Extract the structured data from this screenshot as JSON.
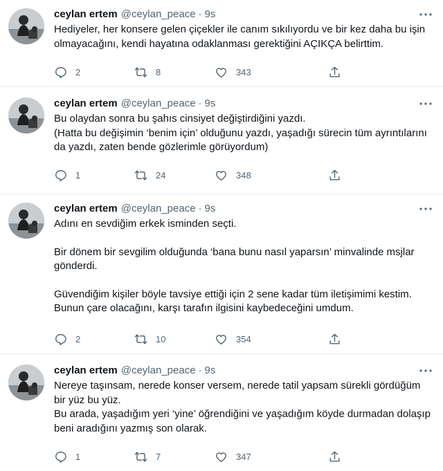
{
  "tweets": [
    {
      "name": "ceylan ertem",
      "handle": "@ceylan_peace",
      "separator": "·",
      "time": "9s",
      "paragraphs": [
        "Hediyeler, her konsere gelen çiçekler ile canım sıkılıyordu ve bir kez daha bu işin olmayacağını, kendi hayatına odaklanması gerektiğini AÇIKÇA belirttim."
      ],
      "replies": "2",
      "retweets": "8",
      "likes": "343"
    },
    {
      "name": "ceylan ertem",
      "handle": "@ceylan_peace",
      "separator": "·",
      "time": "9s",
      "paragraphs": [
        "Bu olaydan sonra bu şahıs cinsiyet değiştirdiğini yazdı.\n(Hatta bu değişimin ‘benim için’ olduğunu yazdı, yaşadığı sürecin tüm ayrıntılarını da yazdı, zaten bende gözlerimle görüyordum)"
      ],
      "replies": "1",
      "retweets": "24",
      "likes": "348"
    },
    {
      "name": "ceylan ertem",
      "handle": "@ceylan_peace",
      "separator": "·",
      "time": "9s",
      "paragraphs": [
        "Adını en sevdiğim erkek isminden seçti.",
        "Bir dönem bir sevgilim olduğunda ‘bana bunu nasıl yaparsın’ minvalinde msjlar gönderdi.",
        "Güvendiğim kişiler böyle tavsiye ettiği için 2 sene kadar tüm iletişimimi kestim. Bunun çare olacağını, karşı tarafın ilgisini kaybedeceğini umdum."
      ],
      "replies": "2",
      "retweets": "10",
      "likes": "354"
    },
    {
      "name": "ceylan ertem",
      "handle": "@ceylan_peace",
      "separator": "·",
      "time": "9s",
      "paragraphs": [
        "Nereye taşınsam, nerede konser versem, nerede tatil yapsam sürekli gördüğüm bir yüz bu yüz.\nBu arada, yaşadığım yeri ‘yine’ öğrendiğini ve yaşadığım köyde durmadan dolaşıp beni aradığını yazmış son olarak."
      ],
      "replies": "1",
      "retweets": "7",
      "likes": "347"
    }
  ],
  "icons": {
    "more": "more-icon",
    "reply": "reply-icon",
    "retweet": "retweet-icon",
    "like": "like-icon",
    "share": "share-icon"
  },
  "colors": {
    "text": "#0f1419",
    "secondary": "#536471",
    "divider": "#e6ecf0"
  }
}
